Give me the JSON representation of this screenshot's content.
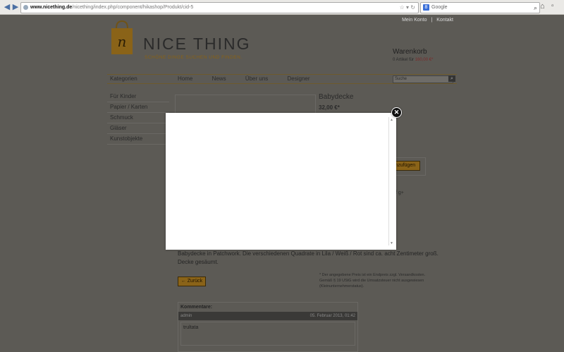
{
  "browser": {
    "url_domain": "www.nicething.de",
    "url_path": "/nicething/index.php/component/hikashop/Produkt/cid-5",
    "search_engine": "Google"
  },
  "site": {
    "topnav": [
      "Mein Konto",
      "|",
      "Kontakt"
    ],
    "logo_letter": "n",
    "title": "NICE THING",
    "tagline": "SCHÖNE DINGE SUCHEN UND FINDEN.",
    "cart_title": "Warenkorb",
    "cart_items": "0 Artikel für",
    "cart_price": "160,00 €*"
  },
  "nav": {
    "categories_label": "Kategorien",
    "menu": [
      "Home",
      "News",
      "Über uns",
      "Designer"
    ],
    "search_placeholder": "Suche"
  },
  "categories": [
    "Für Kinder",
    "Papier / Karten",
    "Schmuck",
    "Gläser",
    "Kunstobjekte"
  ],
  "product": {
    "title": "Babydecke",
    "price": "32,00 €*",
    "add_to_cart": "hinzufügen",
    "share": "f  g+",
    "description": "Babydecke in Patchwork. Die verschiedenen Quadrate in Lila / Weiß / Rot sind ca. acht Zentimeter groß. Decke gesäumt.",
    "note": "* Der angegebene Preis ist ein Endpreis zzgl. Versandkosten. Gemäß § 19 UStG wird die Umsatzsteuer nicht ausgewiesen (Kleinunternehmerstatus).",
    "back": "← Zurück"
  },
  "comments": {
    "header": "Kommentare:",
    "author": "admin",
    "date": "05. Februar 2013, 01:42",
    "text": "trultata"
  },
  "modal": {
    "close_glyph": "✕"
  }
}
